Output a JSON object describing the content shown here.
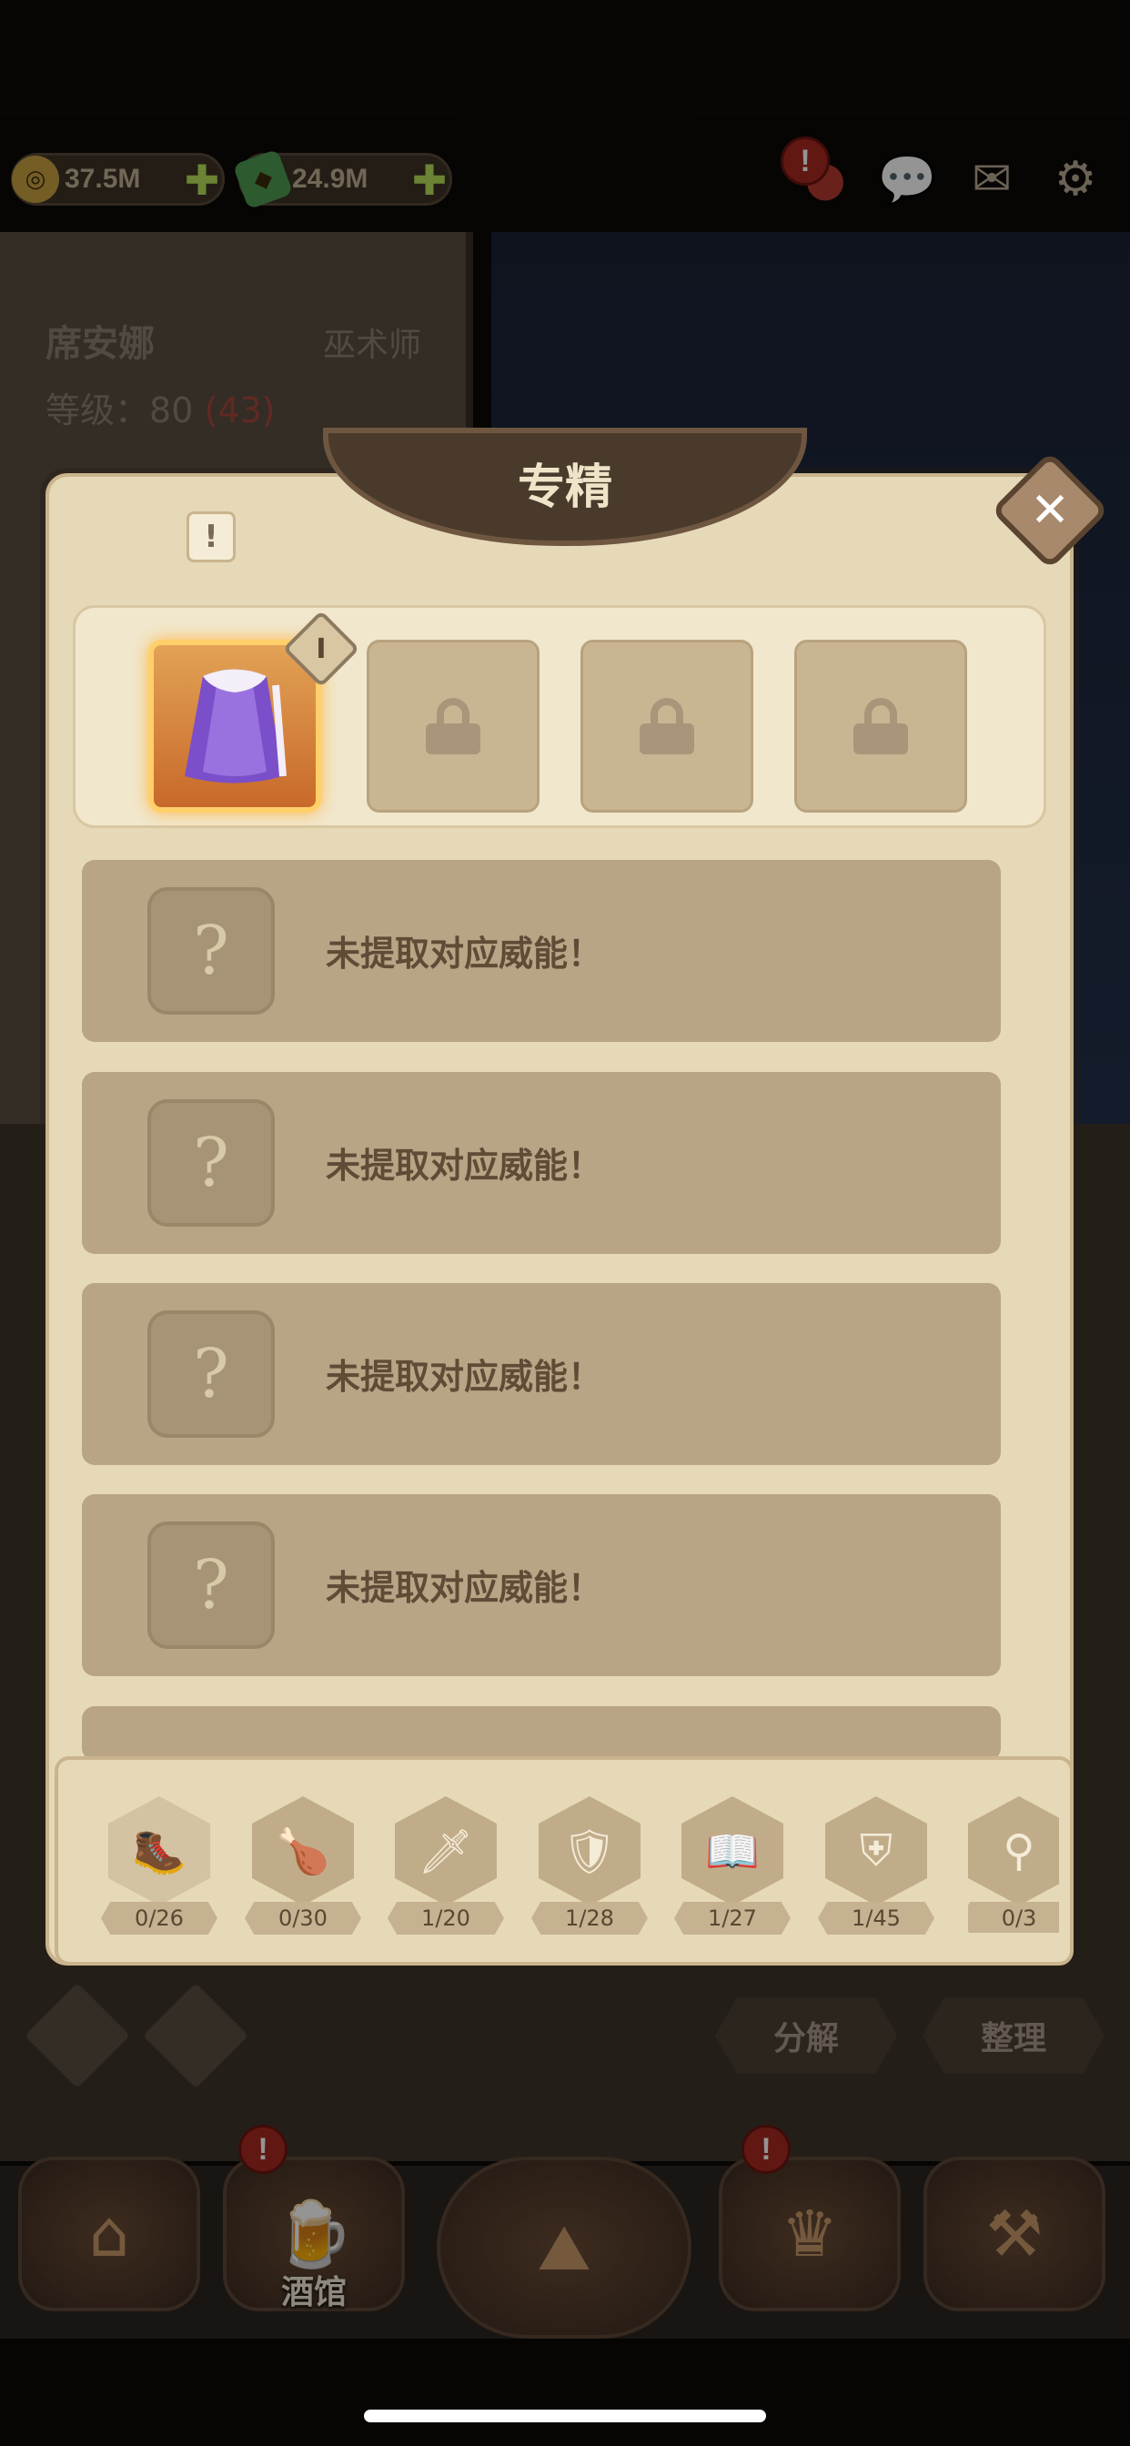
{
  "resources": {
    "gold": "37.5M",
    "gems": "24.9M"
  },
  "hero": {
    "name": "席安娜",
    "class": "巫术师",
    "level_label": "等级：",
    "level": "80",
    "level_bonus_open": "(",
    "level_bonus": "43",
    "level_bonus_close": ")"
  },
  "modal": {
    "title": "专精",
    "info_label": "!",
    "close_label": "✕",
    "gem_label": "Ⅰ",
    "slots": [
      {
        "state": "active",
        "icon": "purple-cloak-icon"
      },
      {
        "state": "locked",
        "icon": "lock-icon"
      },
      {
        "state": "locked",
        "icon": "lock-icon"
      },
      {
        "state": "locked",
        "icon": "lock-icon"
      }
    ],
    "ability_rows": [
      {
        "icon": "?",
        "text": "未提取对应威能！"
      },
      {
        "icon": "?",
        "text": "未提取对应威能！"
      },
      {
        "icon": "?",
        "text": "未提取对应威能！"
      },
      {
        "icon": "?",
        "text": "未提取对应威能！"
      }
    ]
  },
  "categories": [
    {
      "icon": "boot-icon",
      "count": "0/26",
      "glyph": "🥾"
    },
    {
      "icon": "drumstick-icon",
      "count": "0/30",
      "glyph": "🍗"
    },
    {
      "icon": "sword-icon",
      "count": "1/20",
      "glyph": "🗡"
    },
    {
      "icon": "shield-icon",
      "count": "1/28",
      "glyph": "🛡"
    },
    {
      "icon": "book-icon",
      "count": "1/27",
      "glyph": "📖"
    },
    {
      "icon": "armor-icon",
      "count": "1/45",
      "glyph": "⛨"
    },
    {
      "icon": "ring-icon",
      "count": "0/3",
      "glyph": "⚲"
    }
  ],
  "actions": {
    "decompose": "分解",
    "organize": "整理"
  },
  "nav": {
    "tavern": "酒馆"
  },
  "alert_label": "!"
}
